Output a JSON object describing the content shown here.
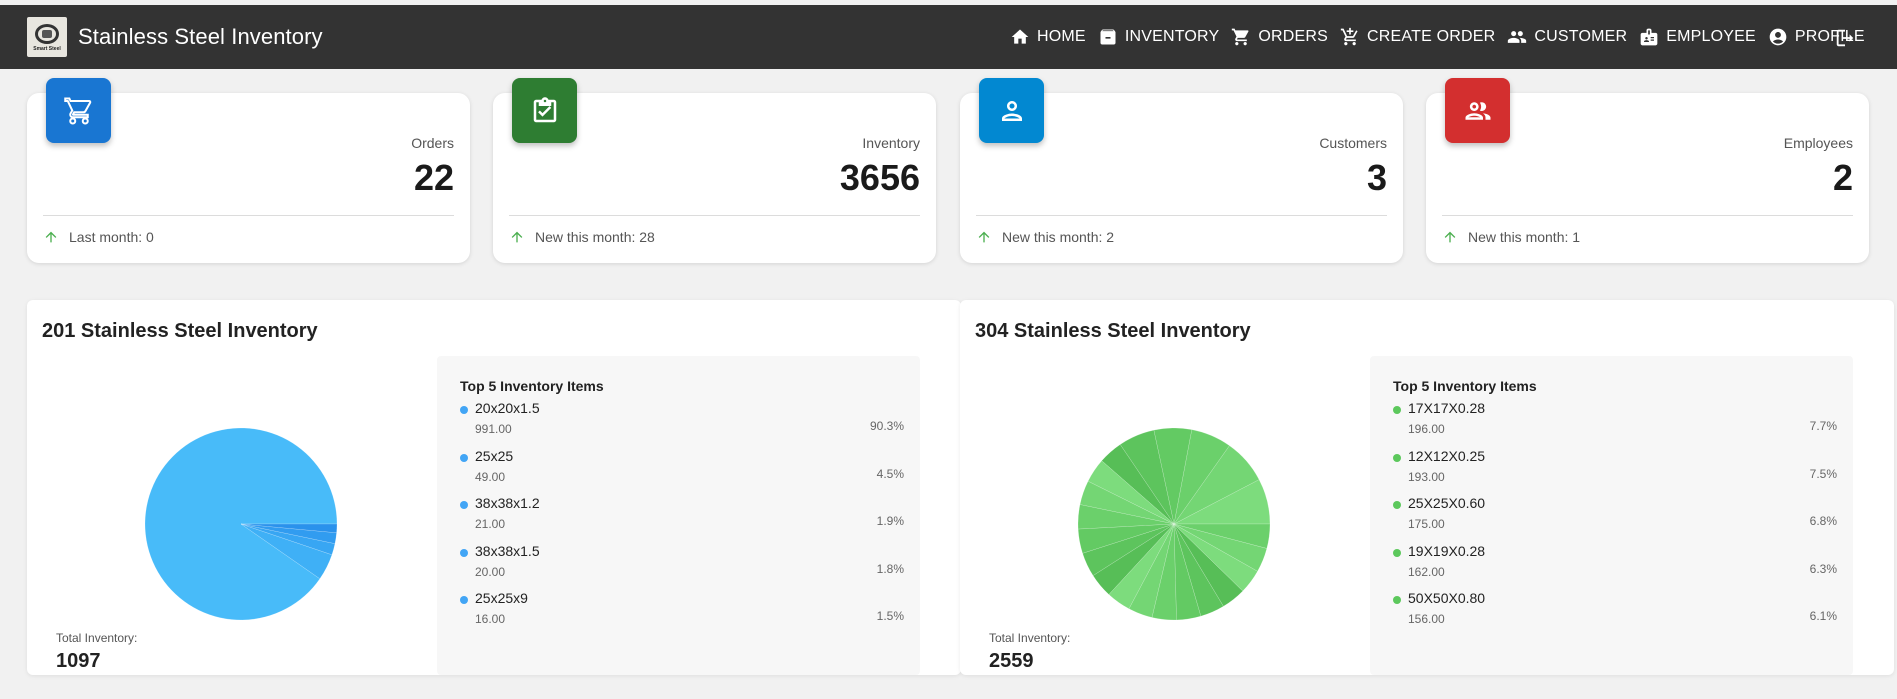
{
  "app": {
    "title": "Stainless Steel Inventory",
    "logo_text": "Smart Steel"
  },
  "nav": [
    {
      "label": "HOME",
      "icon": "home-icon"
    },
    {
      "label": "INVENTORY",
      "icon": "archive-icon"
    },
    {
      "label": "ORDERS",
      "icon": "cart-icon"
    },
    {
      "label": "CREATE ORDER",
      "icon": "add-cart-icon"
    },
    {
      "label": "CUSTOMER",
      "icon": "people-icon"
    },
    {
      "label": "EMPLOYEE",
      "icon": "badge-icon"
    },
    {
      "label": "PROFILE",
      "icon": "account-circle-icon"
    }
  ],
  "logout_icon": "logout-icon",
  "stats": [
    {
      "label": "Orders",
      "value": "22",
      "foot": "Last month: 0",
      "color": "#1976d2",
      "icon": "cart-icon"
    },
    {
      "label": "Inventory",
      "value": "3656",
      "foot": "New this month: 28",
      "color": "#2e7d32",
      "icon": "clipboard-check-icon"
    },
    {
      "label": "Customers",
      "value": "3",
      "foot": "New this month: 2",
      "color": "#0288d1",
      "icon": "person-icon"
    },
    {
      "label": "Employees",
      "value": "2",
      "foot": "New this month: 1",
      "color": "#d32f2f",
      "icon": "group-icon"
    }
  ],
  "panels": [
    {
      "title": "201 Stainless Steel Inventory",
      "top_title": "Top 5 Inventory Items",
      "total_label": "Total Inventory:",
      "total": "1097",
      "dot_color": "#42a5f5",
      "pie_colors": [
        "#48bbf9",
        "#3fb0f6",
        "#38a6f3",
        "#319cf0",
        "#2a92ec",
        "#2388e9"
      ],
      "items": [
        {
          "name": "20x20x1.5",
          "qty": "991.00",
          "pct": "90.3%"
        },
        {
          "name": "25x25",
          "qty": "49.00",
          "pct": "4.5%"
        },
        {
          "name": "38x38x1.2",
          "qty": "21.00",
          "pct": "1.9%"
        },
        {
          "name": "38x38x1.5",
          "qty": "20.00",
          "pct": "1.8%"
        },
        {
          "name": "25x25x9",
          "qty": "16.00",
          "pct": "1.5%"
        }
      ],
      "chart_data": {
        "type": "pie",
        "labels": [
          "20x20x1.5",
          "25x25",
          "38x38x1.2",
          "38x38x1.5",
          "25x25x9"
        ],
        "values": [
          991,
          49,
          21,
          20,
          16
        ]
      }
    },
    {
      "title": "304 Stainless Steel Inventory",
      "top_title": "Top 5 Inventory Items",
      "total_label": "Total Inventory:",
      "total": "2559",
      "dot_color": "#5cc85c",
      "pie_colors": [
        "#7ddc7d",
        "#74d674",
        "#6bd06b",
        "#63ca63",
        "#5dc45d",
        "#57be57"
      ],
      "items": [
        {
          "name": "17X17X0.28",
          "qty": "196.00",
          "pct": "7.7%"
        },
        {
          "name": "12X12X0.25",
          "qty": "193.00",
          "pct": "7.5%"
        },
        {
          "name": "25X25X0.60",
          "qty": "175.00",
          "pct": "6.8%"
        },
        {
          "name": "19X19X0.28",
          "qty": "162.00",
          "pct": "6.3%"
        },
        {
          "name": "50X50X0.80",
          "qty": "156.00",
          "pct": "6.1%"
        }
      ],
      "chart_data": {
        "type": "pie",
        "labels": [
          "17X17X0.28",
          "12X12X0.25",
          "25X25X0.60",
          "19X19X0.28",
          "50X50X0.80"
        ],
        "values": [
          196,
          193,
          175,
          162,
          156
        ]
      }
    }
  ]
}
